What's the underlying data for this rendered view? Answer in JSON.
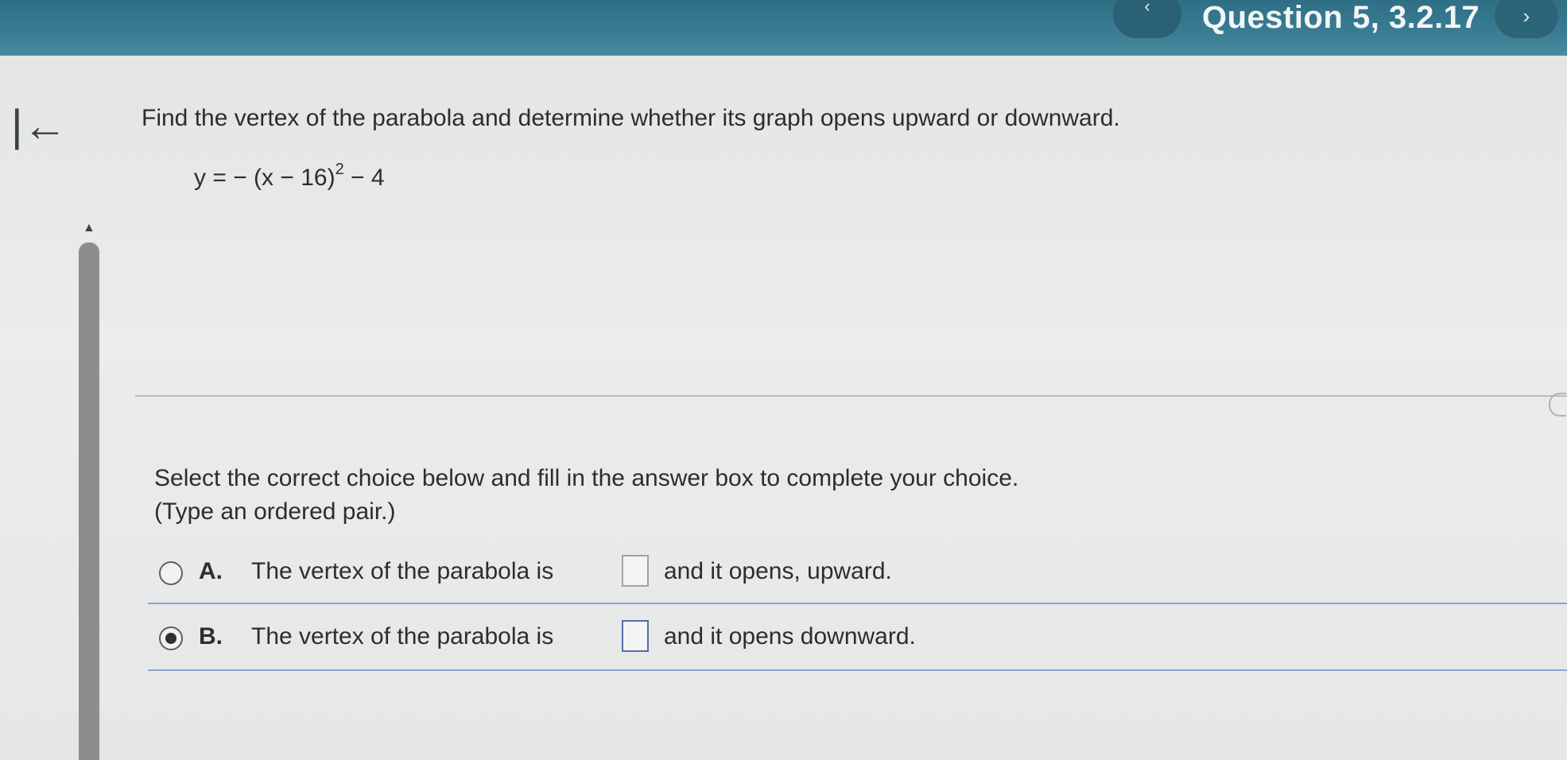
{
  "header": {
    "prev_label": "‹",
    "question_title": "Question 5, 3.2.17",
    "next_label": "›",
    "colors": {
      "bar": "#3a7d93",
      "text": "#f3f5f6"
    }
  },
  "sidebar": {
    "back_icon": "|←",
    "scroll_up_icon": "▲"
  },
  "question": {
    "prompt": "Find the vertex of the parabola and determine whether its graph opens upward or downward.",
    "equation_left": "y = − (x − 16)",
    "equation_exponent": "2",
    "equation_right": " − 4"
  },
  "answer": {
    "instruction": "Select the correct choice below and fill in the answer box to complete your choice.",
    "hint": "(Type an ordered pair.)",
    "choices": [
      {
        "letter": "A.",
        "text": "The vertex of the parabola is",
        "suffix": "and it opens, upward.",
        "selected": false
      },
      {
        "letter": "B.",
        "text": "The vertex of the parabola is",
        "suffix": "and it opens downward.",
        "selected": true
      }
    ]
  }
}
